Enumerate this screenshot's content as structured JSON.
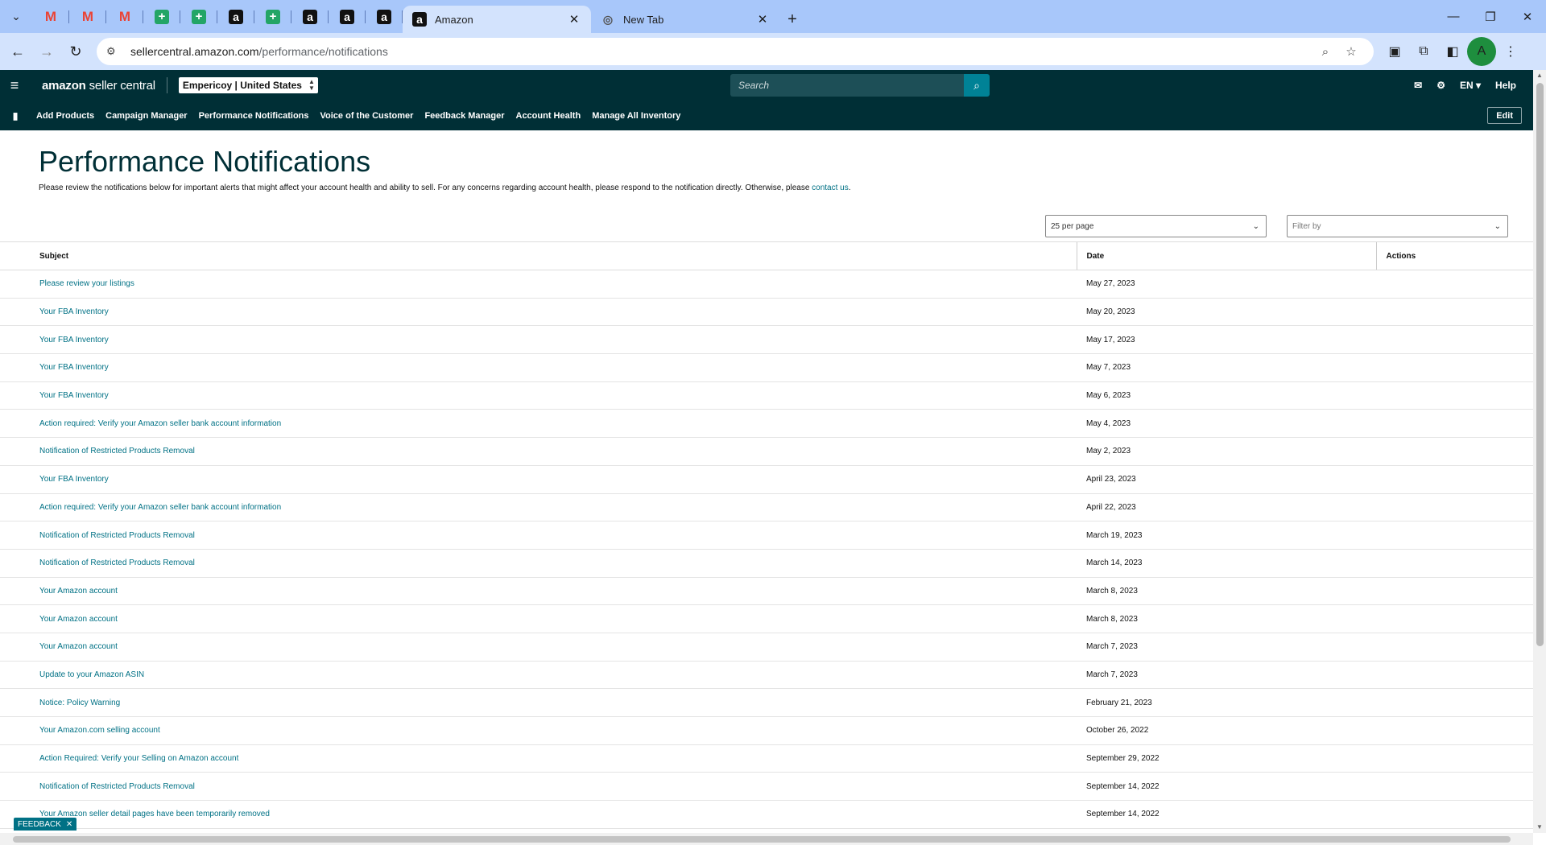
{
  "browser": {
    "tabs": [
      {
        "label": "Amazon",
        "active": true
      },
      {
        "label": "New Tab",
        "active": false
      }
    ],
    "url_host": "sellercentral.amazon.com",
    "url_path": "/performance/notifications",
    "avatar_letter": "A"
  },
  "header": {
    "logo_bold": "amazon",
    "logo_light": " seller central",
    "account": "Empericoy | United States",
    "search_placeholder": "Search",
    "lang": "EN ▾",
    "help": "Help"
  },
  "nav": {
    "items": [
      "Add Products",
      "Campaign Manager",
      "Performance Notifications",
      "Voice of the Customer",
      "Feedback Manager",
      "Account Health",
      "Manage All Inventory"
    ],
    "edit": "Edit"
  },
  "page": {
    "title": "Performance Notifications",
    "description": "Please review the notifications below for important alerts that might affect your account health and ability to sell. For any concerns regarding account health, please respond to the notification directly. Otherwise, please ",
    "description_link": "contact us",
    "description_end": ".",
    "per_page": "25 per page",
    "filter_placeholder": "Filter by"
  },
  "table": {
    "headers": {
      "subject": "Subject",
      "date": "Date",
      "actions": "Actions"
    },
    "rows": [
      {
        "subject": "Please review your listings",
        "date": "May 27, 2023"
      },
      {
        "subject": "Your FBA Inventory",
        "date": "May 20, 2023"
      },
      {
        "subject": "Your FBA Inventory",
        "date": "May 17, 2023"
      },
      {
        "subject": "Your FBA Inventory",
        "date": "May 7, 2023"
      },
      {
        "subject": "Your FBA Inventory",
        "date": "May 6, 2023"
      },
      {
        "subject": "Action required: Verify your Amazon seller bank account information",
        "date": "May 4, 2023"
      },
      {
        "subject": "Notification of Restricted Products Removal",
        "date": "May 2, 2023"
      },
      {
        "subject": "Your FBA Inventory",
        "date": "April 23, 2023"
      },
      {
        "subject": "Action required: Verify your Amazon seller bank account information",
        "date": "April 22, 2023"
      },
      {
        "subject": "Notification of Restricted Products Removal",
        "date": "March 19, 2023"
      },
      {
        "subject": "Notification of Restricted Products Removal",
        "date": "March 14, 2023"
      },
      {
        "subject": "Your Amazon account",
        "date": "March 8, 2023"
      },
      {
        "subject": "Your Amazon account",
        "date": "March 8, 2023"
      },
      {
        "subject": "Your Amazon account",
        "date": "March 7, 2023"
      },
      {
        "subject": "Update to your Amazon ASIN",
        "date": "March 7, 2023"
      },
      {
        "subject": "Notice: Policy Warning",
        "date": "February 21, 2023"
      },
      {
        "subject": "Your Amazon.com selling account",
        "date": "October 26, 2022"
      },
      {
        "subject": "Action Required: Verify your Selling on Amazon account",
        "date": "September 29, 2022"
      },
      {
        "subject": "Notification of Restricted Products Removal",
        "date": "September 14, 2022"
      },
      {
        "subject": "Your Amazon seller detail pages have been temporarily removed",
        "date": "September 14, 2022"
      },
      {
        "subject": "",
        "date": ""
      }
    ]
  },
  "feedback": "FEEDBACK",
  "colors": {
    "header_bg": "#002f36",
    "link": "#007185",
    "tabstrip": "#a8c7fa"
  }
}
